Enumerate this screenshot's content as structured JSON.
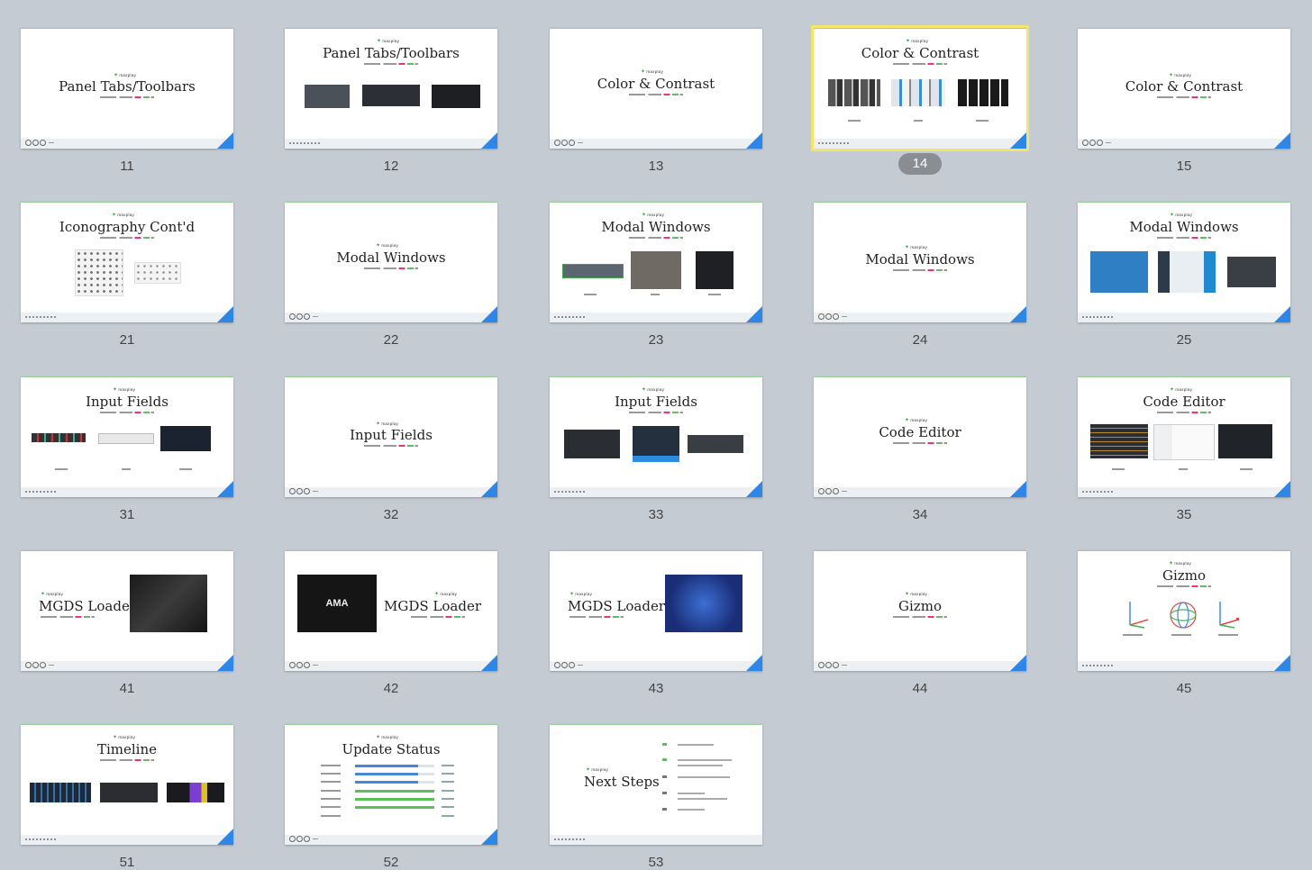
{
  "brand_mark": "maxplay",
  "selected_slide": "14",
  "accent_colors": {
    "corner": "#2e86e6",
    "selection": "#f4e46a",
    "brand_green": "#3aa84a"
  },
  "slides": [
    {
      "number": "11",
      "title": "Panel Tabs/Toolbars"
    },
    {
      "number": "12",
      "title": "Panel Tabs/Toolbars"
    },
    {
      "number": "13",
      "title": "Color & Contrast"
    },
    {
      "number": "14",
      "title": "Color & Contrast"
    },
    {
      "number": "15",
      "title": "Color & Contrast"
    },
    {
      "number": "21",
      "title": "Iconography Cont'd"
    },
    {
      "number": "22",
      "title": "Modal Windows"
    },
    {
      "number": "23",
      "title": "Modal Windows"
    },
    {
      "number": "24",
      "title": "Modal Windows"
    },
    {
      "number": "25",
      "title": "Modal Windows"
    },
    {
      "number": "31",
      "title": "Input Fields"
    },
    {
      "number": "32",
      "title": "Input Fields"
    },
    {
      "number": "33",
      "title": "Input Fields"
    },
    {
      "number": "34",
      "title": "Code Editor"
    },
    {
      "number": "35",
      "title": "Code Editor"
    },
    {
      "number": "41",
      "title": "MGDS Loader"
    },
    {
      "number": "42",
      "title": "MGDS Loader",
      "image_text": "AMA"
    },
    {
      "number": "43",
      "title": "MGDS Loader"
    },
    {
      "number": "44",
      "title": "Gizmo"
    },
    {
      "number": "45",
      "title": "Gizmo"
    },
    {
      "number": "51",
      "title": "Timeline"
    },
    {
      "number": "52",
      "title": "Update Status"
    },
    {
      "number": "53",
      "title": "Next Steps"
    }
  ]
}
